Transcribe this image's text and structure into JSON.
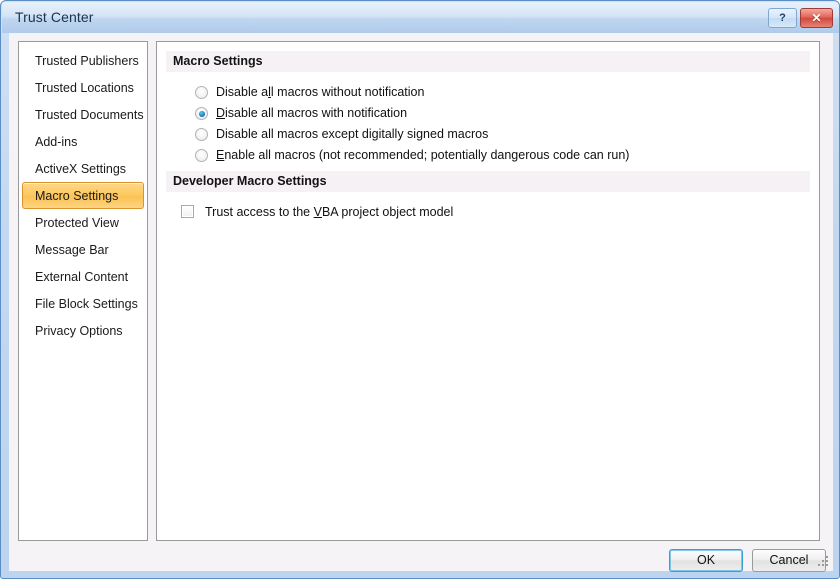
{
  "window": {
    "title": "Trust Center",
    "help_button": "?",
    "close_button": "✕"
  },
  "sidebar": {
    "items": [
      {
        "label": "Trusted Publishers",
        "selected": false
      },
      {
        "label": "Trusted Locations",
        "selected": false
      },
      {
        "label": "Trusted Documents",
        "selected": false
      },
      {
        "label": "Add-ins",
        "selected": false
      },
      {
        "label": "ActiveX Settings",
        "selected": false
      },
      {
        "label": "Macro Settings",
        "selected": true
      },
      {
        "label": "Protected View",
        "selected": false
      },
      {
        "label": "Message Bar",
        "selected": false
      },
      {
        "label": "External Content",
        "selected": false
      },
      {
        "label": "File Block Settings",
        "selected": false
      },
      {
        "label": "Privacy Options",
        "selected": false
      }
    ]
  },
  "main": {
    "macro_settings": {
      "header": "Macro Settings",
      "options": [
        {
          "label": "Disable all macros without notification",
          "checked": false
        },
        {
          "label": "Disable all macros with notification",
          "checked": true
        },
        {
          "label": "Disable all macros except digitally signed macros",
          "checked": false
        },
        {
          "label": "Enable all macros (not recommended; potentially dangerous code can run)",
          "checked": false
        }
      ]
    },
    "developer_macro_settings": {
      "header": "Developer Macro Settings",
      "checkbox_label_before": "Trust access to the ",
      "checkbox_label_accel": "V",
      "checkbox_label_after": "BA project object model",
      "checkbox_checked": false
    }
  },
  "footer": {
    "ok_label": "OK",
    "cancel_label": "Cancel"
  },
  "colors": {
    "titlebar_blue": "#bfd6ef",
    "selection_orange": "#fdc961",
    "selection_border": "#d9952c",
    "section_header_bg": "#f6f1f5",
    "radio_dot_blue": "#1982c4",
    "close_red": "#d04a3e",
    "default_button_focus": "#3c9fd4"
  }
}
